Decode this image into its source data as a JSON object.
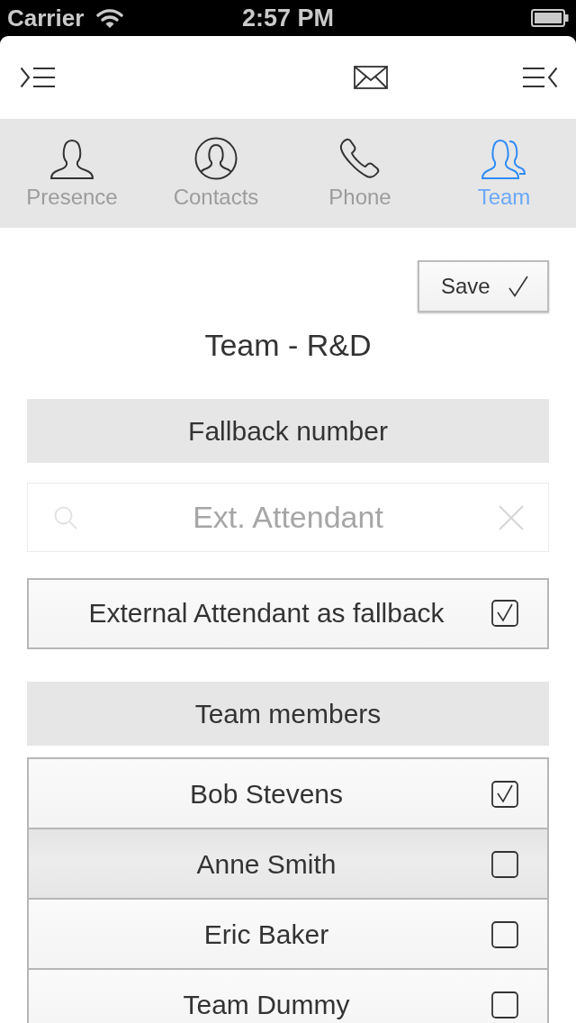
{
  "status_bar": {
    "carrier": "Carrier",
    "time": "2:57 PM"
  },
  "tabs": [
    {
      "label": "Presence",
      "selected": false
    },
    {
      "label": "Contacts",
      "selected": false
    },
    {
      "label": "Phone",
      "selected": false
    },
    {
      "label": "Team",
      "selected": true
    }
  ],
  "save_button": {
    "label": "Save"
  },
  "title": "Team - R&D",
  "fallback": {
    "header": "Fallback number",
    "search": {
      "placeholder": "Ext. Attendant",
      "disabled": true
    },
    "option": {
      "label": "External Attendant as fallback",
      "checked": true
    }
  },
  "members": {
    "header": "Team members",
    "rows": [
      {
        "name": "Bob Stevens",
        "checked": true,
        "selected": false
      },
      {
        "name": "Anne Smith",
        "checked": false,
        "selected": true
      },
      {
        "name": "Eric Baker",
        "checked": false,
        "selected": false
      },
      {
        "name": "Team Dummy",
        "checked": false,
        "selected": false
      }
    ]
  }
}
